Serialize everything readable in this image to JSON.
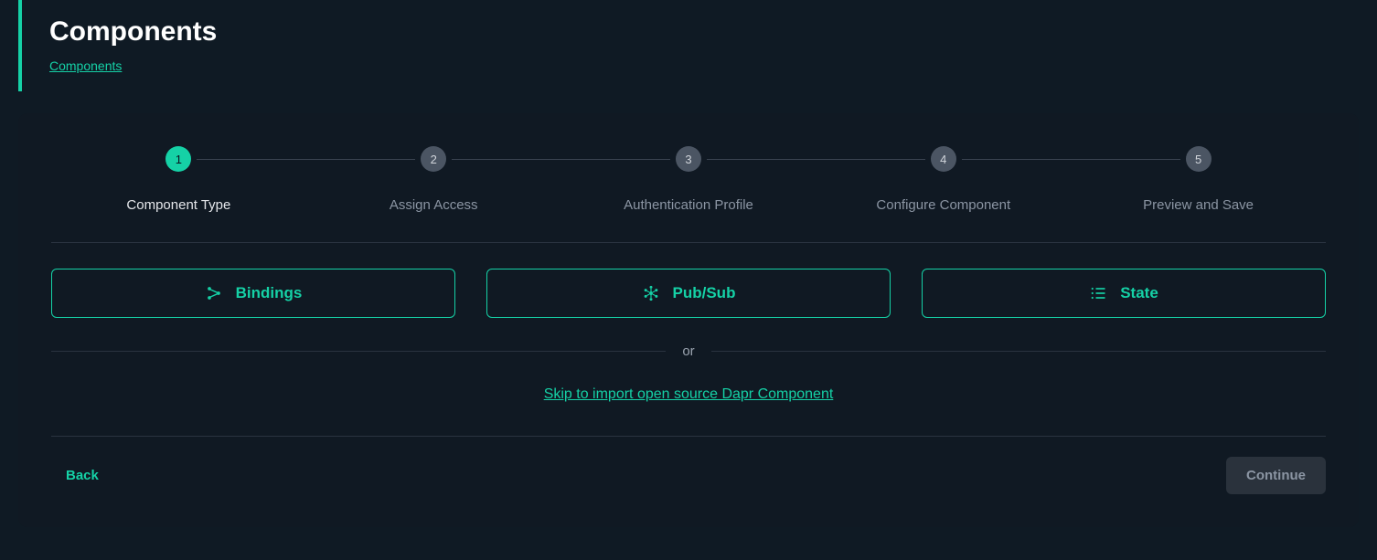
{
  "header": {
    "title": "Components",
    "breadcrumb": "Components"
  },
  "stepper": {
    "steps": [
      {
        "num": "1",
        "label": "Component Type",
        "active": true
      },
      {
        "num": "2",
        "label": "Assign Access",
        "active": false
      },
      {
        "num": "3",
        "label": "Authentication Profile",
        "active": false
      },
      {
        "num": "4",
        "label": "Configure Component",
        "active": false
      },
      {
        "num": "5",
        "label": "Preview and Save",
        "active": false
      }
    ]
  },
  "options": {
    "bindings": "Bindings",
    "pubsub": "Pub/Sub",
    "state": "State"
  },
  "divider_label": "or",
  "import_link": "Skip to import open source Dapr Component",
  "footer": {
    "back": "Back",
    "continue": "Continue"
  },
  "colors": {
    "accent": "#15d1a6",
    "bg_page": "#0f1a24",
    "bg_card": "#101923",
    "text_muted": "#8b95a3"
  }
}
